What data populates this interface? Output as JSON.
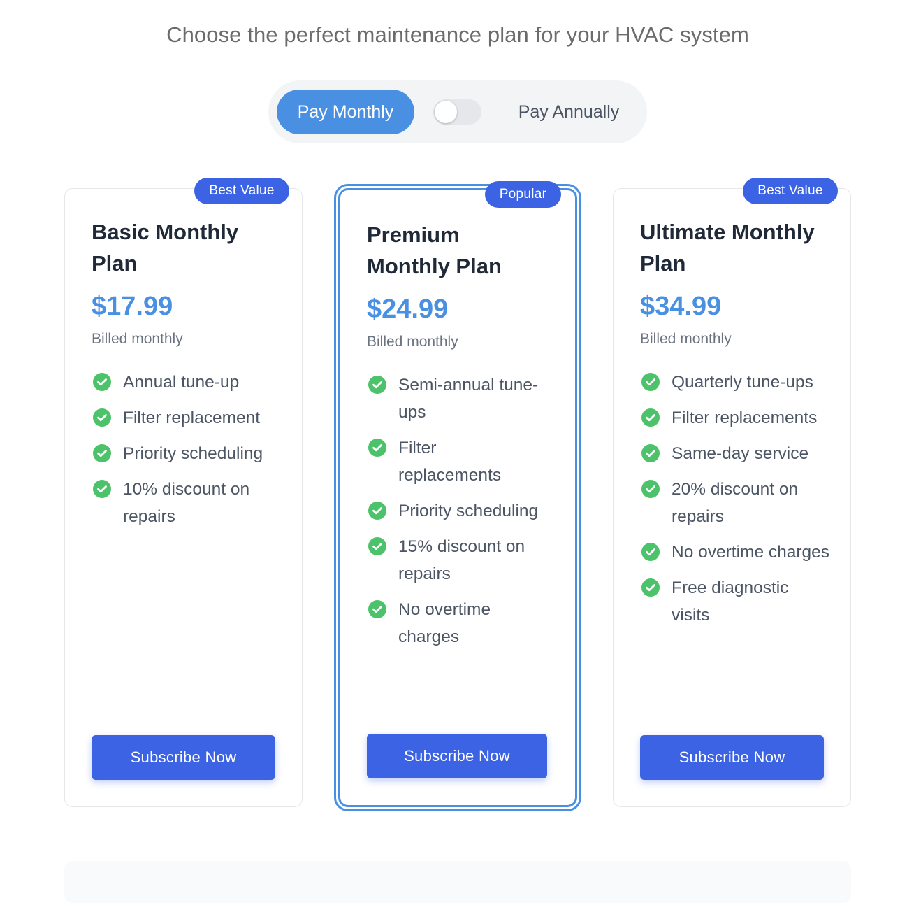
{
  "header": {
    "subtitle": "Choose the perfect maintenance plan for your HVAC system"
  },
  "billing_toggle": {
    "monthly_label": "Pay Monthly",
    "annually_label": "Pay Annually",
    "annual_selected": false
  },
  "colors": {
    "accent": "#4a90e2",
    "button": "#3b63e4",
    "check": "#4cc26a"
  },
  "plans": [
    {
      "badge": "Best Value",
      "name": "Basic Monthly Plan",
      "price": "$17.99",
      "billing": "Billed monthly",
      "features": [
        "Annual tune-up",
        "Filter replacement",
        "Priority scheduling",
        "10% discount on repairs"
      ],
      "cta": "Subscribe Now"
    },
    {
      "badge": "Popular",
      "name": "Premium Monthly Plan",
      "price": "$24.99",
      "billing": "Billed monthly",
      "features": [
        "Semi-annual tune-ups",
        "Filter replacements",
        "Priority scheduling",
        "15% discount on repairs",
        "No overtime charges"
      ],
      "cta": "Subscribe Now"
    },
    {
      "badge": "Best Value",
      "name": "Ultimate Monthly Plan",
      "price": "$34.99",
      "billing": "Billed monthly",
      "features": [
        "Quarterly tune-ups",
        "Filter replacements",
        "Same-day service",
        "20% discount on repairs",
        "No overtime charges",
        "Free diagnostic visits"
      ],
      "cta": "Subscribe Now"
    }
  ]
}
